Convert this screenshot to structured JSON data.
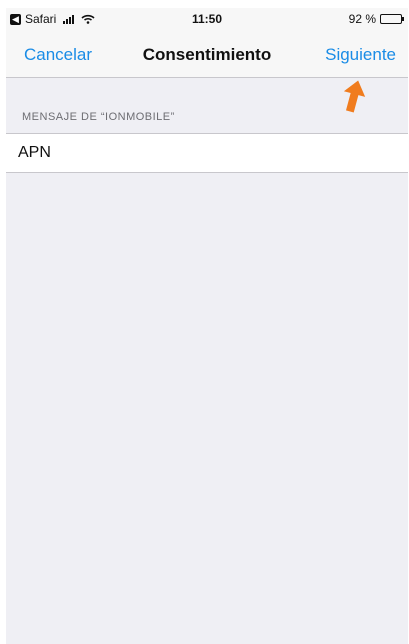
{
  "status_bar": {
    "back_app": "Safari",
    "time": "11:50",
    "battery_percent": "92 %",
    "battery_level": 0.92,
    "icons": [
      "back-app-icon",
      "signal-icon",
      "wifi-icon",
      "battery-icon"
    ]
  },
  "navbar": {
    "cancel_label": "Cancelar",
    "title": "Consentimiento",
    "next_label": "Siguiente"
  },
  "section": {
    "header": "MENSAJE DE “IONMOBILE”",
    "items": [
      {
        "label": "APN"
      }
    ]
  },
  "colors": {
    "accent": "#1a8ce6",
    "annotation_arrow": "#f07c1e",
    "background": "#efeff4"
  }
}
